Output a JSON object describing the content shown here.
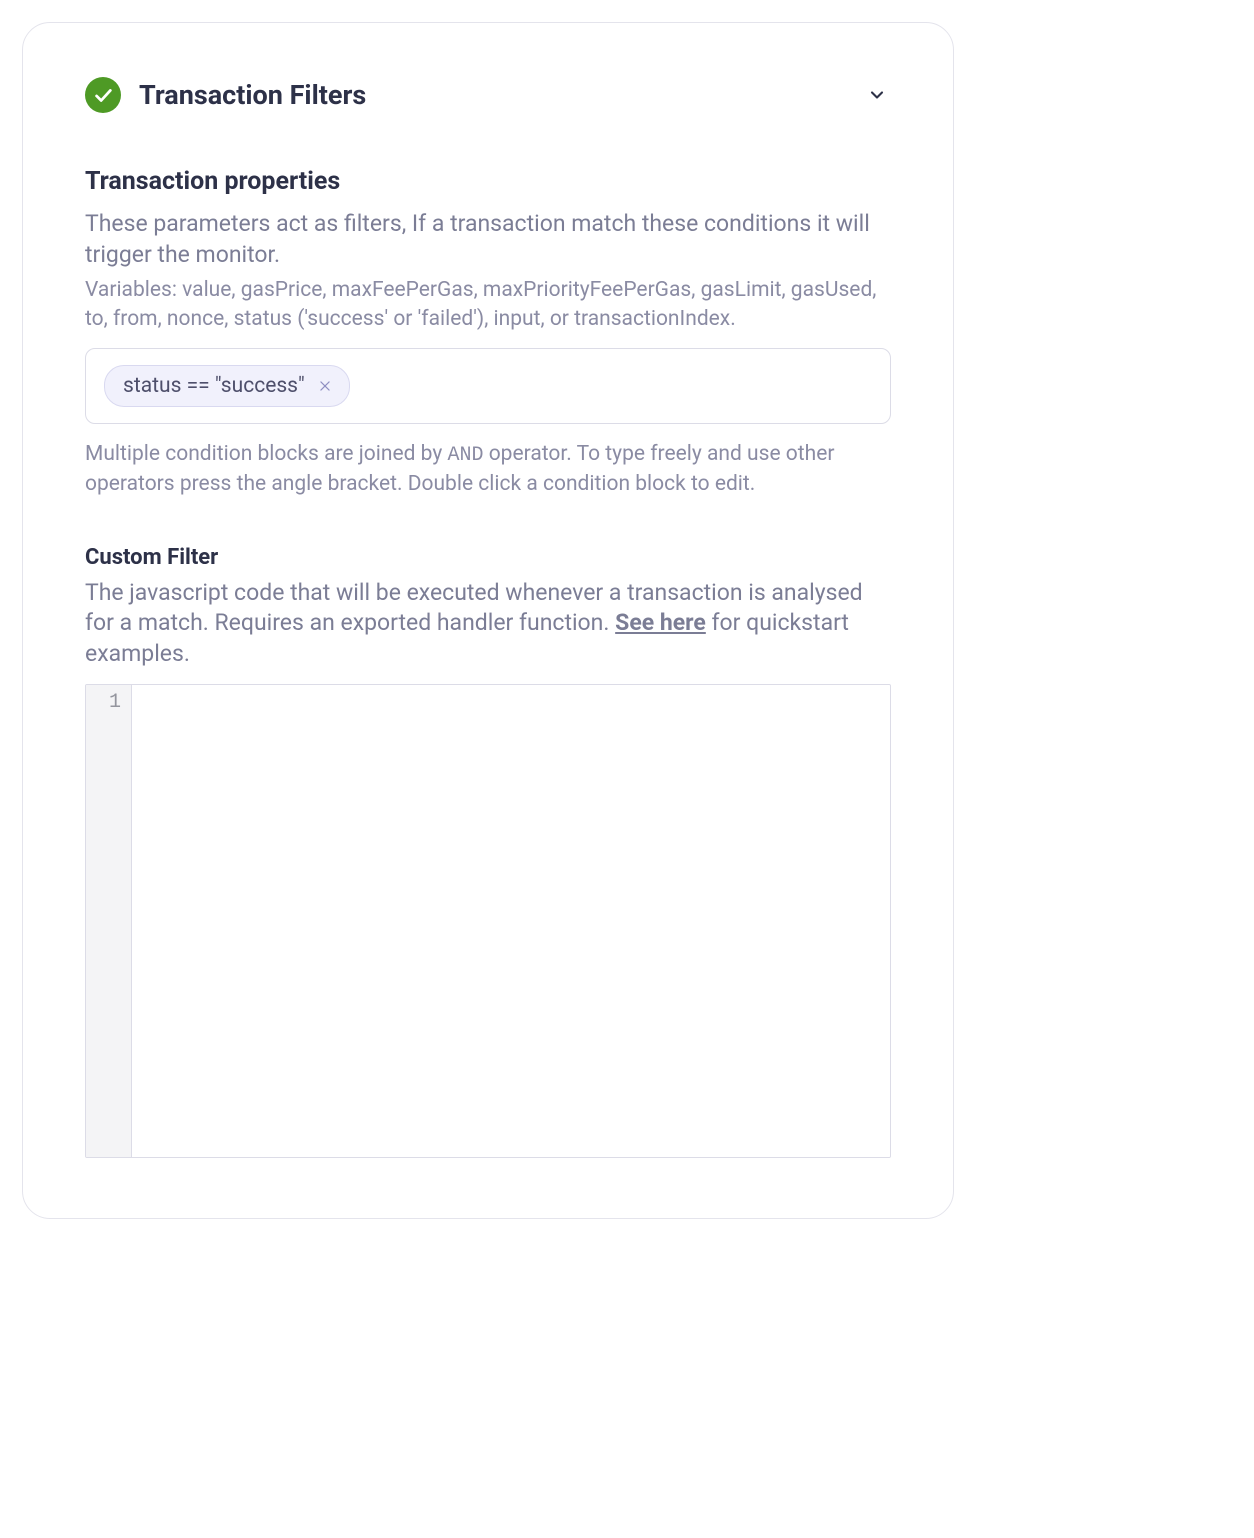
{
  "panel": {
    "title": "Transaction Filters"
  },
  "properties": {
    "heading": "Transaction properties",
    "description": "These parameters act as filters, If a transaction match these conditions it will trigger the monitor.",
    "variables": "Variables: value, gasPrice, maxFeePerGas, maxPriorityFeePerGas, gasLimit, gasUsed, to, from, nonce, status ('success' or 'failed'), input, or transactionIndex.",
    "conditions": [
      {
        "expr": "status == \"success\""
      }
    ],
    "note_pre": "Multiple condition blocks are joined by ",
    "note_op": "AND",
    "note_post": " operator. To type freely and use other operators press the angle bracket. Double click a condition block to edit."
  },
  "custom": {
    "heading": "Custom Filter",
    "desc_pre": "The javascript code that will be executed whenever a transaction is analysed for a match. Requires an exported handler function. ",
    "link_text": "See here",
    "desc_post": " for quickstart examples.",
    "editor": {
      "line_numbers": [
        "1"
      ],
      "content": ""
    }
  },
  "colors": {
    "accent_green": "#4e9a25",
    "chip_bg": "#f1f1fc"
  }
}
